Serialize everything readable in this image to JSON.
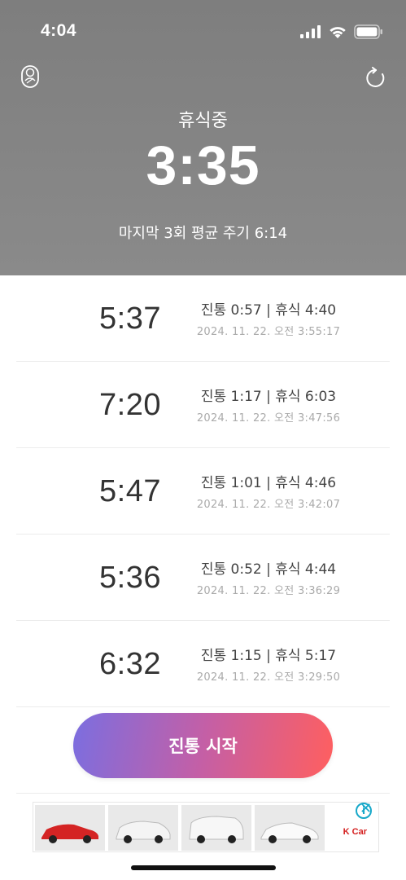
{
  "status_bar": {
    "time": "4:04"
  },
  "header": {
    "state_label": "휴식중",
    "timer": "3:35",
    "summary": "마지막 3회 평균 주기 6:14"
  },
  "icons": {
    "baby": "baby-icon",
    "refresh": "refresh-icon",
    "signal": "signal-icon",
    "wifi": "wifi-icon",
    "battery": "battery-icon"
  },
  "records": [
    {
      "interval": "5:37",
      "detail": "진통 0:57 | 휴식 4:40",
      "timestamp": "2024. 11. 22. 오전 3:55:17"
    },
    {
      "interval": "7:20",
      "detail": "진통 1:17 | 휴식 6:03",
      "timestamp": "2024. 11. 22. 오전 3:47:56"
    },
    {
      "interval": "5:47",
      "detail": "진통 1:01 | 휴식 4:46",
      "timestamp": "2024. 11. 22. 오전 3:42:07"
    },
    {
      "interval": "5:36",
      "detail": "진통 0:52 | 휴식 4:44",
      "timestamp": "2024. 11. 22. 오전 3:36:29"
    },
    {
      "interval": "6:32",
      "detail": "진통 1:15 | 휴식 5:17",
      "timestamp": "2024. 11. 22. 오전 3:29:50"
    }
  ],
  "start_button": {
    "label": "진통 시작"
  },
  "ad": {
    "brand": "K Car",
    "info": "i",
    "close": "✕"
  },
  "colors": {
    "header_bg": "#828282",
    "button_gradient_start": "#7b6ee0",
    "button_gradient_end": "#ff5f5f"
  }
}
